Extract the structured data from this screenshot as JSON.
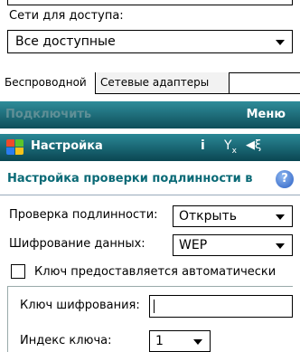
{
  "previous_screen": {
    "network_label": "Сети для доступа:",
    "network_value": "Все доступные",
    "tabs": [
      {
        "label": "Беспроводной"
      },
      {
        "label": "Сетевые адаптеры"
      }
    ],
    "softkey_left": "Подключить",
    "softkey_right": "Меню"
  },
  "titlebar": {
    "title": "Настройка",
    "icons": [
      "start-flag-icon",
      "connectivity-icon",
      "signal-off-icon",
      "speaker-icon"
    ]
  },
  "page": {
    "heading": "Настройка проверки подлинности в",
    "help_glyph": "?"
  },
  "form": {
    "authentication": {
      "label": "Проверка подлинности:",
      "value": "Открыть"
    },
    "encryption": {
      "label": "Шифрование данных:",
      "value": "WEP"
    },
    "auto_key": {
      "label": "Ключ предоставляется автоматически",
      "checked": false
    },
    "network_key": {
      "label": "Ключ шифрования:",
      "value": ""
    },
    "key_index": {
      "label": "Индекс ключа:",
      "value": "1"
    }
  },
  "colors": {
    "titlebar": "#0e5a66",
    "heading_text": "#0a6a76",
    "help_icon": "#2a5fc4"
  }
}
